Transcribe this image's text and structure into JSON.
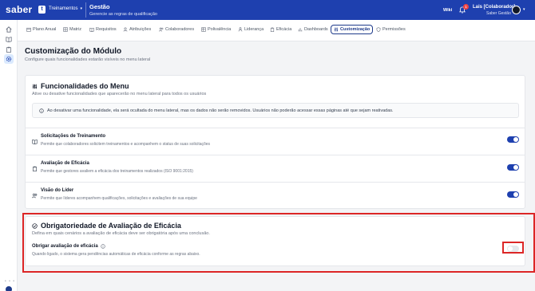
{
  "header": {
    "logo": "saber",
    "logo_badge": "t",
    "module": "Treinamentos",
    "title": "Gestão",
    "subtitle": "Gerencie as regras de qualificação",
    "wiki": "Wiki",
    "notifications": "1",
    "user_name": "Lais [Colaborador]",
    "user_role": "Saber Gestão"
  },
  "tabs": [
    {
      "label": "Plano Anual",
      "icon": "calendar-icon"
    },
    {
      "label": "Matriz",
      "icon": "grid-icon"
    },
    {
      "label": "Requisitos",
      "icon": "book-icon"
    },
    {
      "label": "Atribuições",
      "icon": "user-icon"
    },
    {
      "label": "Colaboradores",
      "icon": "users-icon"
    },
    {
      "label": "Polivalência",
      "icon": "table-icon"
    },
    {
      "label": "Liderança",
      "icon": "people-icon"
    },
    {
      "label": "Eficácia",
      "icon": "clipboard-icon"
    },
    {
      "label": "Dashboards",
      "icon": "bar-chart-icon"
    },
    {
      "label": "Customização",
      "icon": "sliders-icon",
      "active": true
    },
    {
      "label": "Permissões",
      "icon": "shield-icon"
    }
  ],
  "page": {
    "title": "Customização do Módulo",
    "subtitle": "Configure quais funcionalidades estarão visíveis no menu lateral"
  },
  "menu_section": {
    "title": "Funcionalidades do Menu",
    "subtitle": "Ative ou desative funcionalidades que aparecerão no menu lateral para todos os usuários",
    "info": "Ao desativar uma funcionalidade, ela será ocultada do menu lateral, mas os dados não serão removidos. Usuários não poderão acessar essas páginas até que sejam reativadas.",
    "rows": [
      {
        "title": "Solicitações de Treinamento",
        "desc": "Permite que colaboradores solicitem treinamentos e acompanhem o status de suas solicitações",
        "enabled": true,
        "icon": "book-icon"
      },
      {
        "title": "Avaliação de Eficácia",
        "desc": "Permite que gestores avaliem a eficácia dos treinamentos realizados (ISO 9001:2015)",
        "enabled": true,
        "icon": "clipboard-icon"
      },
      {
        "title": "Visão do Líder",
        "desc": "Permite que líderes acompanhem qualificações, solicitações e avaliações de sua equipe",
        "enabled": true,
        "icon": "people-icon"
      }
    ]
  },
  "mandatory_section": {
    "title": "Obrigatoriedade de Avaliação de Eficácia",
    "subtitle": "Defina em quais cenários a avaliação de eficácia deve ser obrigatória após uma conclusão.",
    "option_title": "Obrigar avaliação de eficácia",
    "option_desc": "Quando ligado, o sistema gera pendências automáticas de eficácia conforme as regras abaixo.",
    "enabled": false
  },
  "colors": {
    "brand": "#1e40af",
    "highlight": "#dc2626"
  }
}
